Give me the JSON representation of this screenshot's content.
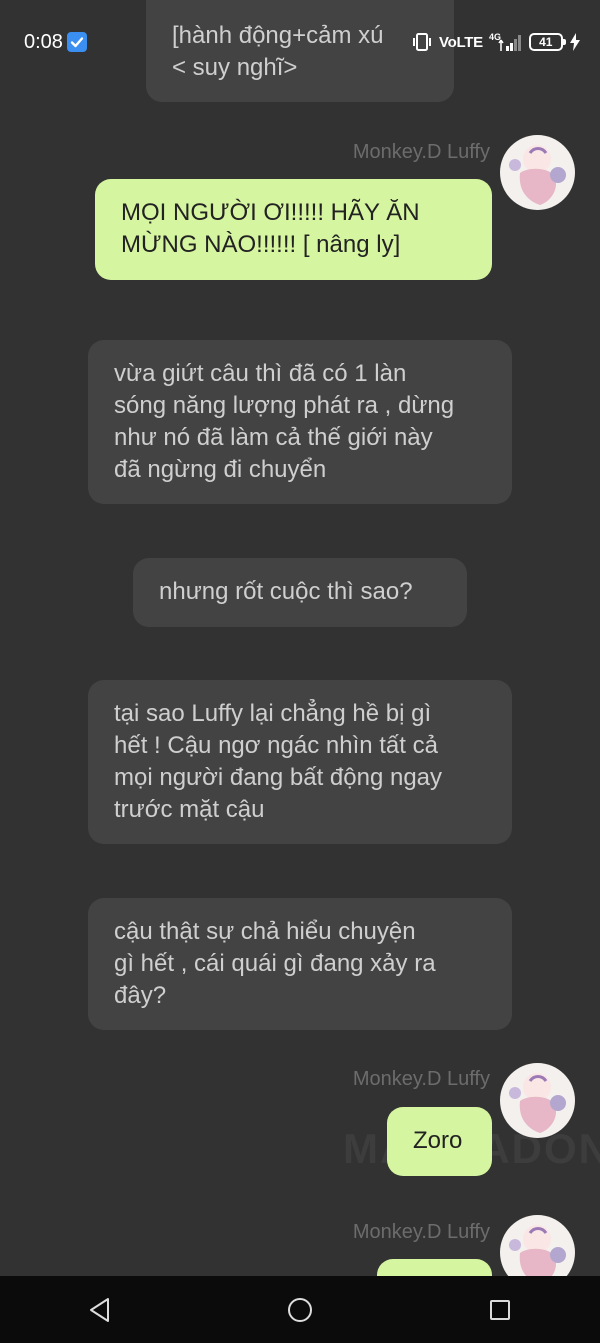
{
  "status_bar": {
    "time": "0:08",
    "network": "VoLTE",
    "network_type": "4G",
    "battery": "41"
  },
  "messages": [
    {
      "id": "top",
      "text_lines": [
        "[hành động+cảm xú",
        "< suy nghĩ>"
      ]
    },
    {
      "id": "u1",
      "sender": "Monkey.D Luffy",
      "text_lines": [
        "MỌI NGƯỜI ƠI!!!!! HÃY ĂN",
        "MỪNG NÀO!!!!!! [ nâng ly]"
      ]
    },
    {
      "id": "n1",
      "text_lines": [
        "vừa giứt câu thì đã có 1 làn",
        "sóng năng lượng phát ra , dừng",
        "như nó đã làm cả thế giới này",
        "đã ngừng đi chuyển"
      ]
    },
    {
      "id": "n2",
      "text_lines": [
        "nhưng rốt cuộc thì sao?"
      ]
    },
    {
      "id": "n3",
      "text_lines": [
        "tại sao Luffy lại chẳng hề bị gì",
        "hết ! Cậu ngơ ngác nhìn tất cả",
        "mọi người đang bất động ngay",
        "trước mặt cậu"
      ]
    },
    {
      "id": "n4",
      "text_lines": [
        "cậu thật sự chả hiểu chuyện",
        "gì hết , cái quái gì đang xảy ra",
        "đây?"
      ]
    },
    {
      "id": "u2",
      "sender": "Monkey.D Luffy",
      "text_lines": [
        "Zoro"
      ]
    },
    {
      "id": "u3",
      "sender": "Monkey.D Luffy",
      "text_lines": []
    }
  ],
  "watermark": "MANGADON",
  "colors": {
    "background": "#323232",
    "narration_bubble": "#434343",
    "user_bubble": "#d6f5a0",
    "sender_name": "#6c6c6c",
    "nav_bar": "#0b0b0b"
  }
}
